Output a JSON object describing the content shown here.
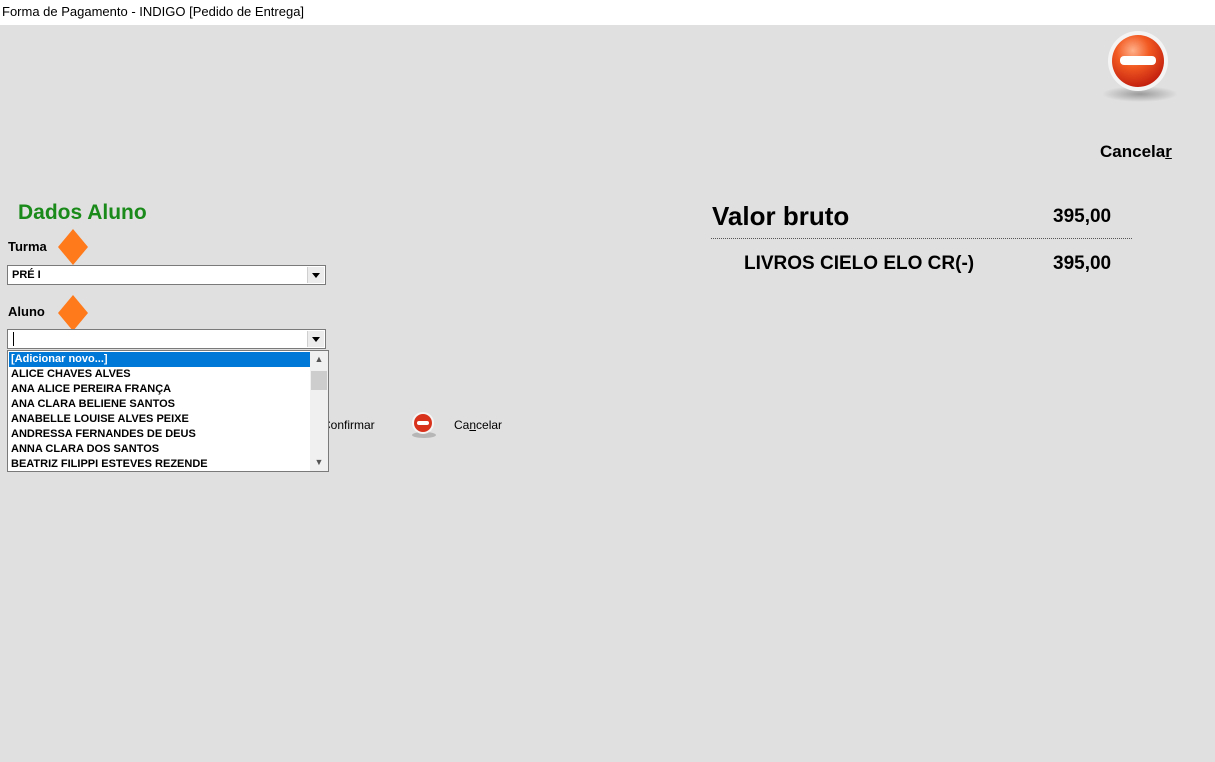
{
  "window": {
    "title": "Forma de Pagamento - INDIGO [Pedido de Entrega]"
  },
  "header": {
    "cancel_label_prefix": "Cancela",
    "cancel_label_hotkey": "r"
  },
  "form": {
    "section_title": "Dados Aluno",
    "turma_label": "Turma",
    "turma_value": "PRÉ I",
    "aluno_label": "Aluno",
    "aluno_value": "",
    "aluno_options": [
      "[Adicionar novo...]",
      "ALICE CHAVES ALVES",
      "ANA ALICE PEREIRA FRANÇA",
      "ANA CLARA BELIENE SANTOS",
      "ANABELLE LOUISE ALVES PEIXE",
      "ANDRESSA FERNANDES DE DEUS",
      "ANNA CLARA DOS SANTOS",
      "BEATRIZ FILIPPI ESTEVES REZENDE"
    ],
    "confirm_label": "Confirmar",
    "cancel_label_a": "Ca",
    "cancel_label_hotkey": "n",
    "cancel_label_b": "celar"
  },
  "summary": {
    "valor_bruto_label": "Valor bruto",
    "valor_bruto_amount": "395,00",
    "payment_name": "LIVROS CIELO ELO CR(-)",
    "payment_amount": "395,00"
  },
  "colors": {
    "accent_green": "#1a8a1a",
    "required_marker": "#ff7a1a",
    "selection_blue": "#0078d7",
    "cancel_red": "#e0301e"
  }
}
